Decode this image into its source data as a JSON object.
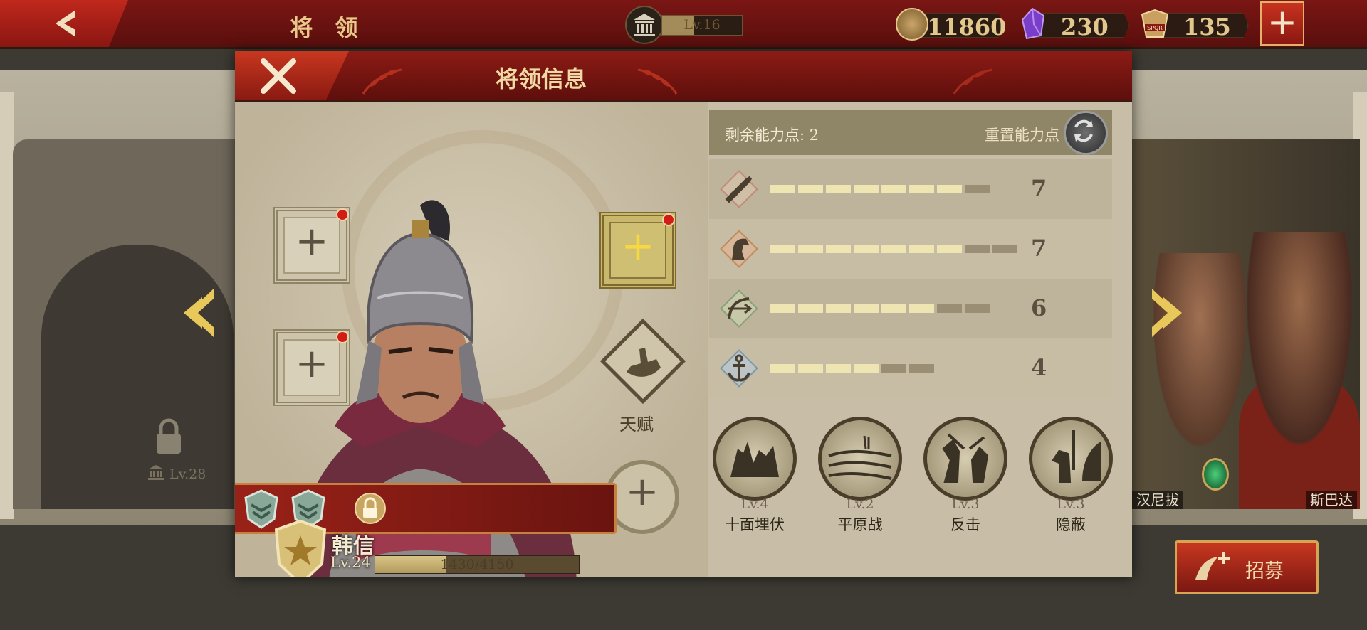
{
  "topbar": {
    "title": "将 领",
    "building_level": "Lv.16",
    "coins": "11860",
    "gems": "230",
    "emblems": "135",
    "emblem_text": "SPQR"
  },
  "dialog": {
    "title": "将领信息",
    "talent_label": "天赋",
    "hero": {
      "name": "韩信",
      "level": "Lv.24",
      "xp": "1430/4150",
      "xp_fraction": 0.345
    },
    "points_label": "剩余能力点: 2",
    "reset_label": "重置能力点",
    "stats": [
      {
        "icon": "sword-icon",
        "value": "7",
        "filled": 7,
        "total": 8
      },
      {
        "icon": "horse-icon",
        "value": "7",
        "filled": 7,
        "total": 9
      },
      {
        "icon": "bow-icon",
        "value": "6",
        "filled": 6,
        "total": 8
      },
      {
        "icon": "anchor-icon",
        "value": "4",
        "filled": 4,
        "total": 6
      }
    ],
    "skills": [
      {
        "level": "Lv.4",
        "name": "十面埋伏"
      },
      {
        "level": "Lv.2",
        "name": "平原战"
      },
      {
        "level": "Lv.3",
        "name": "反击"
      },
      {
        "level": "Lv.3",
        "name": "隐蔽"
      }
    ]
  },
  "background": {
    "locked_level": "Lv.28",
    "right_names": [
      "汉尼拔",
      "斯巴达"
    ]
  },
  "recruit_label": "招募",
  "colors": {
    "header_red": "#7a1614",
    "gold": "#e3c88e",
    "parchment": "#c8bea7"
  }
}
